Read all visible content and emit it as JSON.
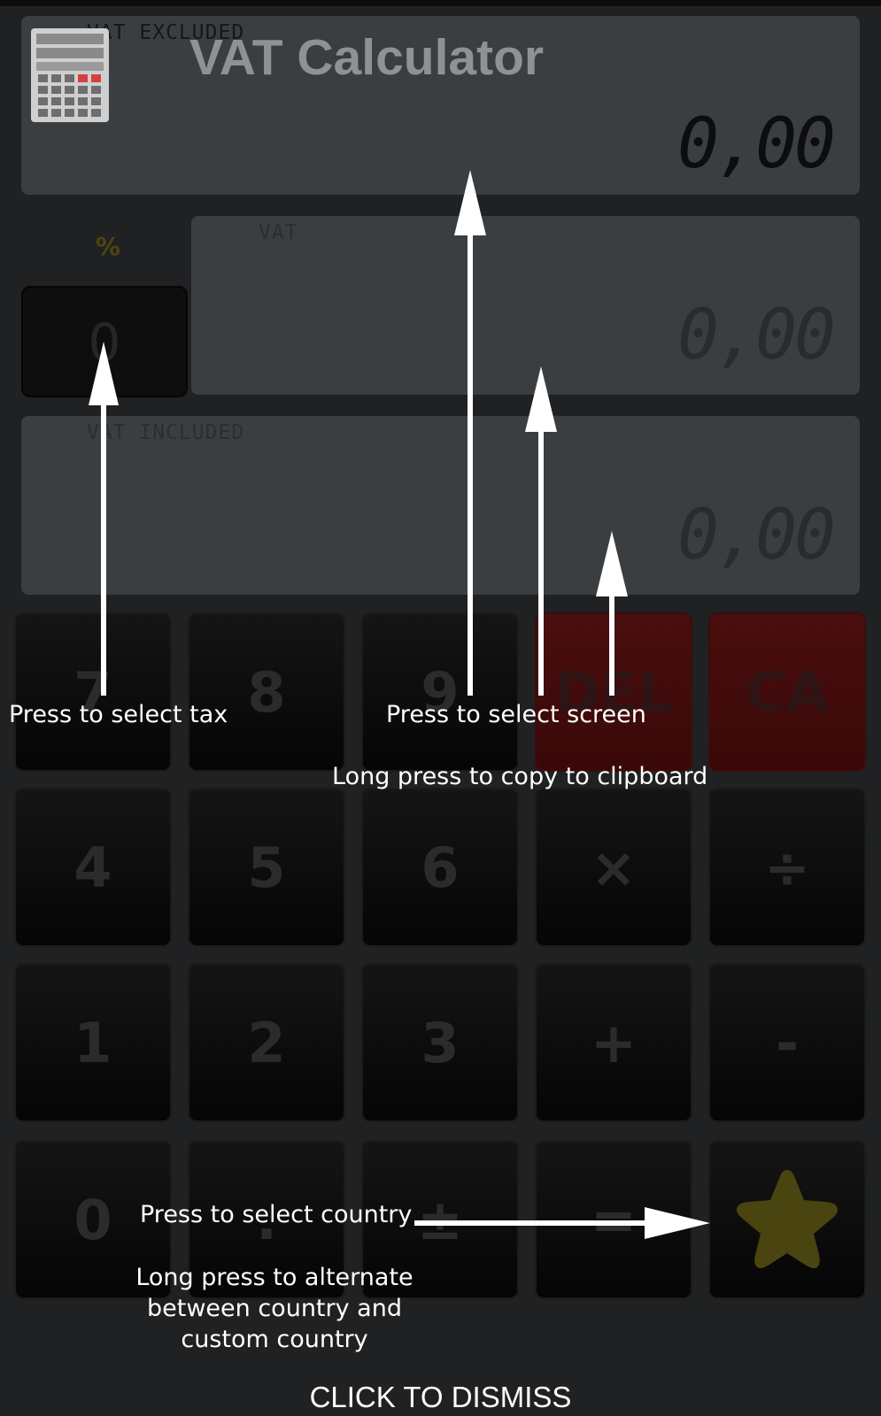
{
  "app": {
    "title": "VAT Calculator",
    "icon": "calculator-icon"
  },
  "screens": {
    "excluded": {
      "label": "VAT EXCLUDED",
      "value": "0,00"
    },
    "vat": {
      "label": "VAT",
      "value": "0,00"
    },
    "included": {
      "label": "VAT INCLUDED",
      "value": "0,00"
    }
  },
  "tax": {
    "symbol": "%",
    "value": "0"
  },
  "keypad": {
    "row1": [
      "7",
      "8",
      "9",
      "DEL",
      "CA"
    ],
    "row2": [
      "4",
      "5",
      "6",
      "×",
      "÷"
    ],
    "row3": [
      "1",
      "2",
      "3",
      "+",
      "-"
    ],
    "row4": [
      "0",
      ".",
      "±",
      "="
    ],
    "favorite_icon": "star-icon"
  },
  "hints": {
    "select_tax": "Press to select tax",
    "select_screen": "Press to select screen",
    "copy_clipboard": "Long press to copy to clipboard",
    "select_country": "Press to select country",
    "alternate_country_1": "Long press to alternate",
    "alternate_country_2": "between country and",
    "alternate_country_3": "custom country",
    "dismiss": "CLICK TO DISMISS"
  },
  "colors": {
    "background": "#202122",
    "screen": "#3b3e41",
    "delete_key": "#4a0e0e",
    "star": "#4a4410"
  }
}
